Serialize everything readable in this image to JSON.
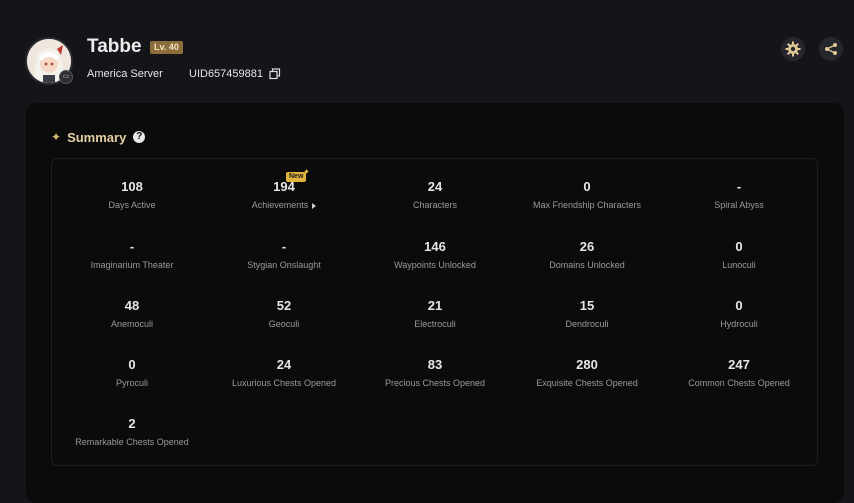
{
  "profile": {
    "name": "Tabbe",
    "level": "Lv. 40",
    "server": "America Server",
    "uid": "UID657459881"
  },
  "icons": {
    "settings": "gear-icon",
    "share": "share-icon",
    "copy": "copy-icon",
    "help": "question-icon"
  },
  "summary": {
    "title": "Summary",
    "new_badge": "New",
    "stats": [
      {
        "value": "108",
        "label": "Days Active"
      },
      {
        "value": "194",
        "label": "Achievements"
      },
      {
        "value": "24",
        "label": "Characters"
      },
      {
        "value": "0",
        "label": "Max Friendship Characters"
      },
      {
        "value": "-",
        "label": "Spiral Abyss"
      },
      {
        "value": "-",
        "label": "Imaginarium Theater"
      },
      {
        "value": "-",
        "label": "Stygian Onslaught"
      },
      {
        "value": "146",
        "label": "Waypoints Unlocked"
      },
      {
        "value": "26",
        "label": "Domains Unlocked"
      },
      {
        "value": "0",
        "label": "Lunoculi"
      },
      {
        "value": "48",
        "label": "Anemoculi"
      },
      {
        "value": "52",
        "label": "Geoculi"
      },
      {
        "value": "21",
        "label": "Electroculi"
      },
      {
        "value": "15",
        "label": "Dendroculi"
      },
      {
        "value": "0",
        "label": "Hydroculi"
      },
      {
        "value": "0",
        "label": "Pyroculi"
      },
      {
        "value": "24",
        "label": "Luxurious Chests Opened"
      },
      {
        "value": "83",
        "label": "Precious Chests Opened"
      },
      {
        "value": "280",
        "label": "Exquisite Chests Opened"
      },
      {
        "value": "247",
        "label": "Common Chests Opened"
      },
      {
        "value": "2",
        "label": "Remarkable Chests Opened"
      }
    ]
  },
  "colors": {
    "background": "#141519",
    "panel": "#0b0b0c",
    "accent_gold": "#e4cfa3",
    "level_badge": "#8a6d3b",
    "new_badge": "#e1b33f"
  }
}
